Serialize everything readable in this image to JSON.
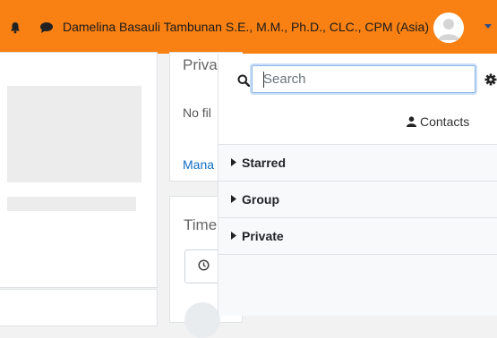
{
  "navbar": {
    "user_name": "Damelina Basauli Tambunan S.E., M.M., Ph.D., CLC., CPM (Asia)",
    "bg_color": "#f98012",
    "notifications_icon": "bell-icon",
    "messages_icon": "chat-icon",
    "user_menu_icon": "caret-down-icon"
  },
  "page": {
    "private_files_title": "Priva",
    "no_files_text": "No fil",
    "manage_link": "Mana",
    "timeline_title": "Time"
  },
  "drawer": {
    "search": {
      "placeholder": "Search",
      "value": ""
    },
    "contacts_label": "Contacts",
    "sections": [
      {
        "label": "Starred"
      },
      {
        "label": "Group"
      },
      {
        "label": "Private"
      }
    ],
    "accent_color": "#8fb8e6"
  }
}
